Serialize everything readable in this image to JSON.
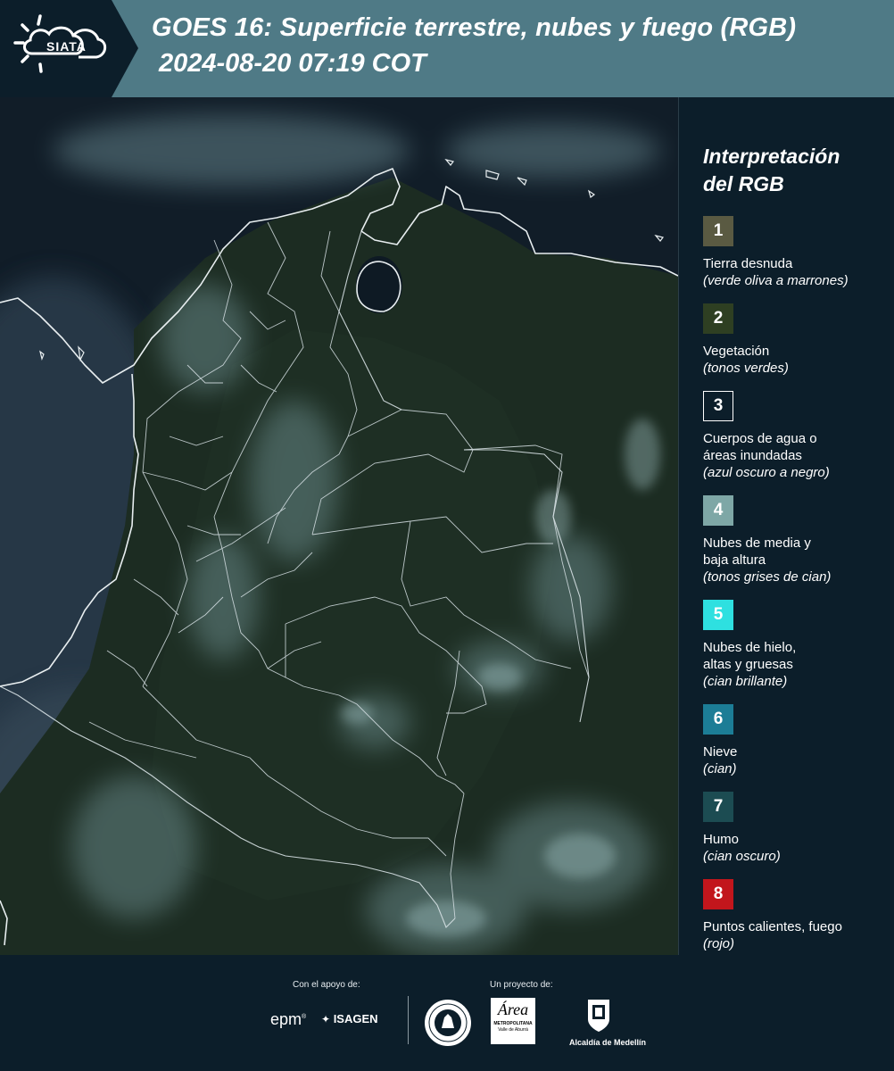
{
  "header": {
    "logo_text": "SIATA",
    "title": "GOES 16: Superficie terrestre, nubes y fuego (RGB)",
    "subtitle": "2024-08-20 07:19 COT"
  },
  "legend": {
    "title_line1": "Interpretación",
    "title_line2": "del RGB",
    "items": [
      {
        "number": "1",
        "color": "#5a5a42",
        "name": "Tierra desnuda",
        "desc": "(verde oliva a marrones)"
      },
      {
        "number": "2",
        "color": "#2e3f22",
        "name": "Vegetación",
        "desc": "(tonos verdes)"
      },
      {
        "number": "3",
        "color": "#0c1e2a",
        "name": "Cuerpos de agua o áreas inundadas",
        "desc": "(azul oscuro a negro)"
      },
      {
        "number": "4",
        "color": "#7ea7a6",
        "name": "Nubes de media y baja altura",
        "desc": "(tonos grises de cian)"
      },
      {
        "number": "5",
        "color": "#2ee0e0",
        "name": "Nubes de hielo, altas y gruesas",
        "desc": "(cian brillante)"
      },
      {
        "number": "6",
        "color": "#1c7d96",
        "name": "Nieve",
        "desc": "(cian)"
      },
      {
        "number": "7",
        "color": "#1c4c52",
        "name": "Humo",
        "desc": "(cian oscuro)"
      },
      {
        "number": "8",
        "color": "#c2161c",
        "name": "Puntos calientes, fuego",
        "desc": "(rojo)"
      }
    ]
  },
  "footer": {
    "support_label": "Con el apoyo de:",
    "project_label": "Un proyecto de:",
    "epm": "epm",
    "isagen": "ISAGEN",
    "area_top": "Área",
    "area_sub": "METROPOLITANA",
    "area_sub2": "Valle de Aburrá",
    "alcaldia": "Alcaldía de Medellín"
  }
}
